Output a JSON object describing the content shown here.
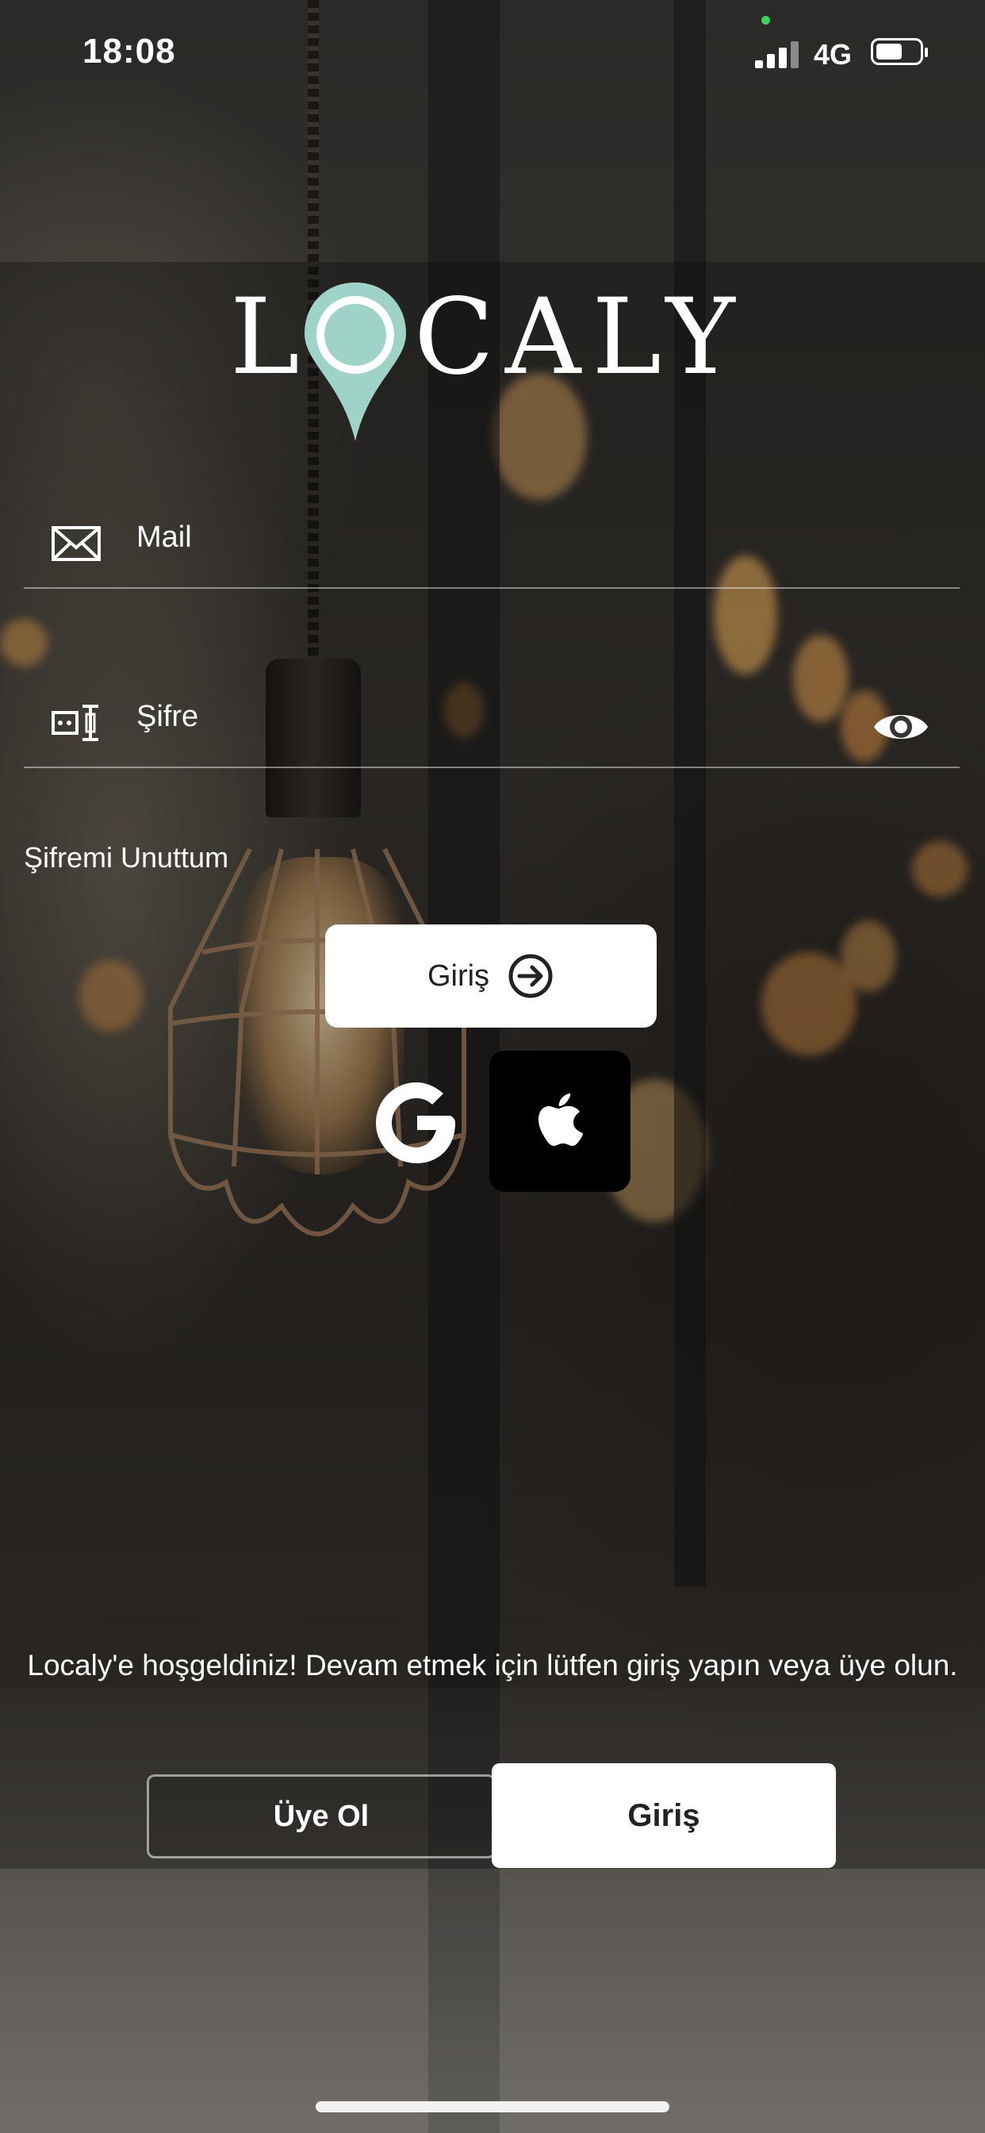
{
  "status_bar": {
    "time": "18:08",
    "network": "4G"
  },
  "logo": {
    "text_left": "L",
    "text_right": "CALY",
    "pin_color": "#9fd3c7"
  },
  "form": {
    "mail_label": "Mail",
    "password_label": "Şifre",
    "forgot_label": "Şifremi Unuttum",
    "login_button": "Giriş"
  },
  "social": {
    "google_icon": "google-g-icon",
    "apple_icon": "apple-logo-icon"
  },
  "welcome_text": "Localy'e hoşgeldiniz! Devam etmek için lütfen giriş yapın veya üye olun.",
  "segments": {
    "signup": "Üye Ol",
    "login": "Giriş"
  }
}
